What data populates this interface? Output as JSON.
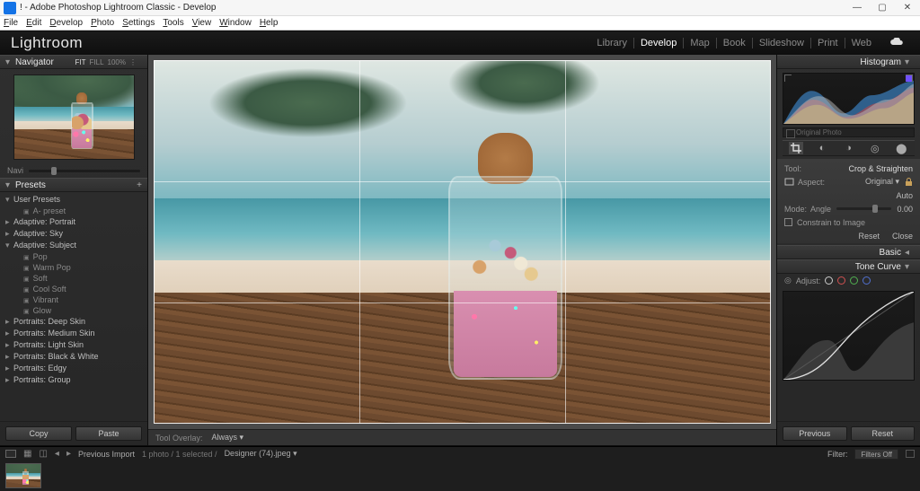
{
  "window": {
    "title": "! - Adobe Photoshop Lightroom Classic - Develop",
    "minimize": "—",
    "maximize": "▢",
    "close": "✕"
  },
  "menubar": [
    "File",
    "Edit",
    "Develop",
    "Photo",
    "Settings",
    "Tools",
    "View",
    "Window",
    "Help"
  ],
  "identity": {
    "brand": "Lightroom",
    "modules": [
      "Library",
      "Develop",
      "Map",
      "Book",
      "Slideshow",
      "Print",
      "Web"
    ],
    "selected": "Develop"
  },
  "left": {
    "navigator": {
      "title": "Navigator",
      "zoom": [
        "FIT",
        "FILL",
        "100%",
        "⋮"
      ]
    },
    "navSlider": {
      "label": "Navi"
    },
    "presets": {
      "title": "Presets",
      "groups": [
        {
          "label": "User Presets",
          "open": true,
          "children": [
            {
              "label": "A- preset"
            }
          ]
        },
        {
          "label": "Adaptive: Portrait",
          "open": false
        },
        {
          "label": "Adaptive: Sky",
          "open": false
        },
        {
          "label": "Adaptive: Subject",
          "open": true,
          "children": [
            {
              "label": "Pop"
            },
            {
              "label": "Warm Pop"
            },
            {
              "label": "Soft"
            },
            {
              "label": "Cool Soft"
            },
            {
              "label": "Vibrant"
            },
            {
              "label": "Glow"
            }
          ]
        },
        {
          "label": "Portraits: Deep Skin",
          "open": false
        },
        {
          "label": "Portraits: Medium Skin",
          "open": false
        },
        {
          "label": "Portraits: Light Skin",
          "open": false
        },
        {
          "label": "Portraits: Black & White",
          "open": false
        },
        {
          "label": "Portraits: Edgy",
          "open": false
        },
        {
          "label": "Portraits: Group",
          "open": false
        }
      ]
    },
    "buttons": {
      "copy": "Copy",
      "paste": "Paste"
    }
  },
  "center": {
    "toolbar": {
      "overlayLabel": "Tool Overlay:",
      "overlayValue": "Always ▾"
    }
  },
  "right": {
    "histogram": {
      "title": "Histogram"
    },
    "originalPhoto": "Original Photo",
    "crop": {
      "title": "Crop & Straighten",
      "toolLabel": "Tool:",
      "aspectLabel": "Aspect:",
      "aspectValue": "Original ▾",
      "autoLabel": "Auto",
      "modeLabel": "Mode:",
      "angleLabel": "Angle",
      "angleValue": "0.00",
      "constrain": "Constrain to Image",
      "reset": "Reset",
      "close": "Close"
    },
    "basic": {
      "title": "Basic"
    },
    "toneCurve": {
      "title": "Tone Curve",
      "adjust": "Adjust:"
    },
    "buttons": {
      "previous": "Previous",
      "reset": "Reset"
    }
  },
  "filmstrip": {
    "source": "Previous Import",
    "count": "1 photo / 1 selected /",
    "filename": "Designer (74).jpeg ▾",
    "filterLabel": "Filter:",
    "filtersOff": "Filters Off"
  }
}
